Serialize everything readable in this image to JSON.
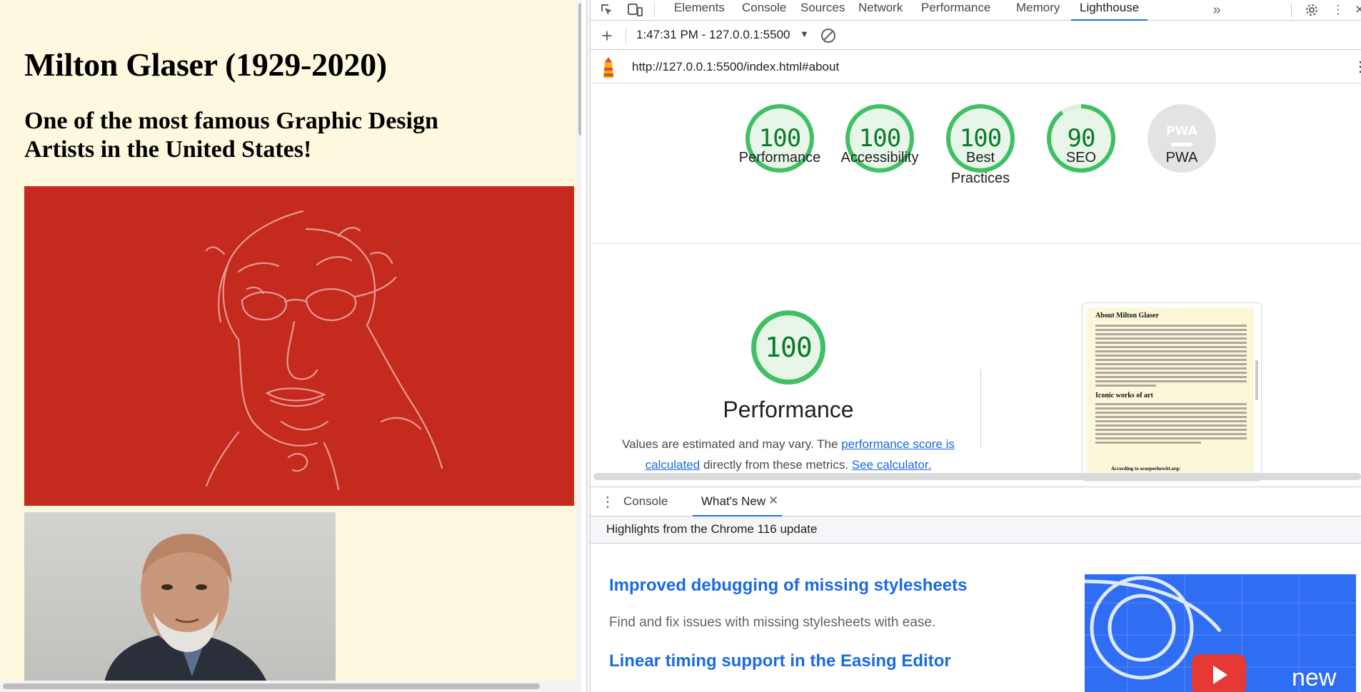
{
  "page": {
    "heading": "Milton Glaser (1929-2020)",
    "subheading": "One of the most famous Graphic Design Artists in the United States!"
  },
  "devtools": {
    "tabs": [
      "Elements",
      "Console",
      "Sources",
      "Network",
      "Performance",
      "Memory",
      "Lighthouse"
    ],
    "active_tab": "Lighthouse",
    "more_tabs_icon": "chevron-double-right-icon",
    "report_selector": "1:47:31 PM - 127.0.0.1:5500",
    "audited_url": "http://127.0.0.1:5500/index.html#about",
    "scores": [
      {
        "label": "Performance",
        "value": "100"
      },
      {
        "label": "Accessibility",
        "value": "100"
      },
      {
        "label": "Best Practices",
        "value": "100"
      },
      {
        "label": "SEO",
        "value": "90"
      },
      {
        "label": "PWA",
        "value": "PWA"
      }
    ],
    "seo_score_fraction": 0.9,
    "performance_section": {
      "score": "100",
      "title": "Performance",
      "desc_prefix": "Values are estimated and may vary. The ",
      "desc_link1": "performance score is calculated",
      "desc_middle": " directly from these metrics. ",
      "desc_link2": "See calculator."
    },
    "thumbnail": {
      "heading1": "About Milton Glaser",
      "heading2": "Iconic works of art",
      "quote": "According to ocooperhewitt.org:"
    },
    "drawer": {
      "tabs": [
        "Console",
        "What's New"
      ],
      "active_tab": "What's New",
      "highlights": "Highlights from the Chrome 116 update",
      "items": [
        {
          "title": "Improved debugging of missing stylesheets",
          "text": "Find and fix issues with missing stylesheets with ease."
        },
        {
          "title": "Linear timing support in the Easing Editor"
        }
      ],
      "promo_label": "new"
    },
    "colors": {
      "accent": "#1a73e8",
      "pass": "#3fc163",
      "pass_text": "#0a7a2a",
      "link": "#1a6ae0"
    }
  }
}
